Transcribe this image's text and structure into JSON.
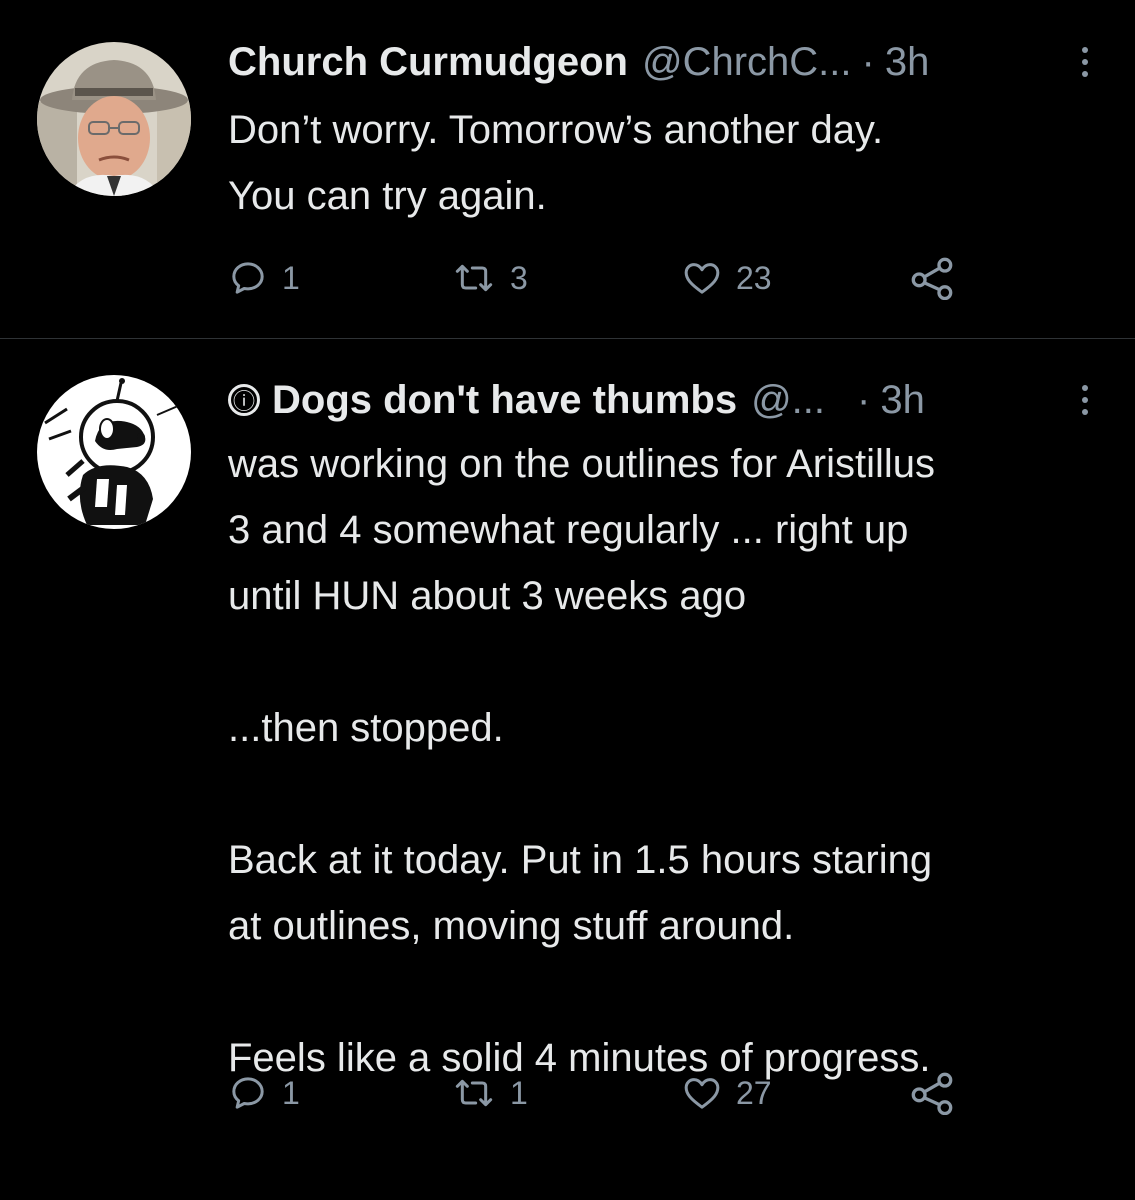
{
  "tweets": [
    {
      "display_name": "Church Curmudgeon",
      "handle": "@ChrchC...",
      "separator": "·",
      "time": "3h",
      "text": "Don’t worry. Tomorrow’s another day.\nYou can try again.",
      "replies": "1",
      "retweets": "3",
      "likes": "23",
      "avatar": "man-in-hat-photo"
    },
    {
      "info_icon": "ⓘ",
      "display_name": "Dogs don't have thumbs",
      "handle": "@...",
      "separator": "·",
      "time": "3h",
      "text": "was working on the outlines for Aristillus\n3 and 4 somewhat regularly ... right up\nuntil HUN about 3 weeks ago\n\n...then stopped.\n\nBack at it today.  Put in 1.5 hours staring\nat outlines, moving stuff around.\n\nFeels like a solid 4 minutes of progress.",
      "replies": "1",
      "retweets": "1",
      "likes": "27",
      "avatar": "astronaut-dog-drawing"
    }
  ],
  "colors": {
    "background": "#000000",
    "text_primary": "#e7e9ea",
    "text_secondary": "#8b98a5",
    "divider": "#2f3336"
  },
  "icons": [
    "reply-icon",
    "retweet-icon",
    "like-icon",
    "share-icon",
    "more-icon",
    "info-icon"
  ]
}
